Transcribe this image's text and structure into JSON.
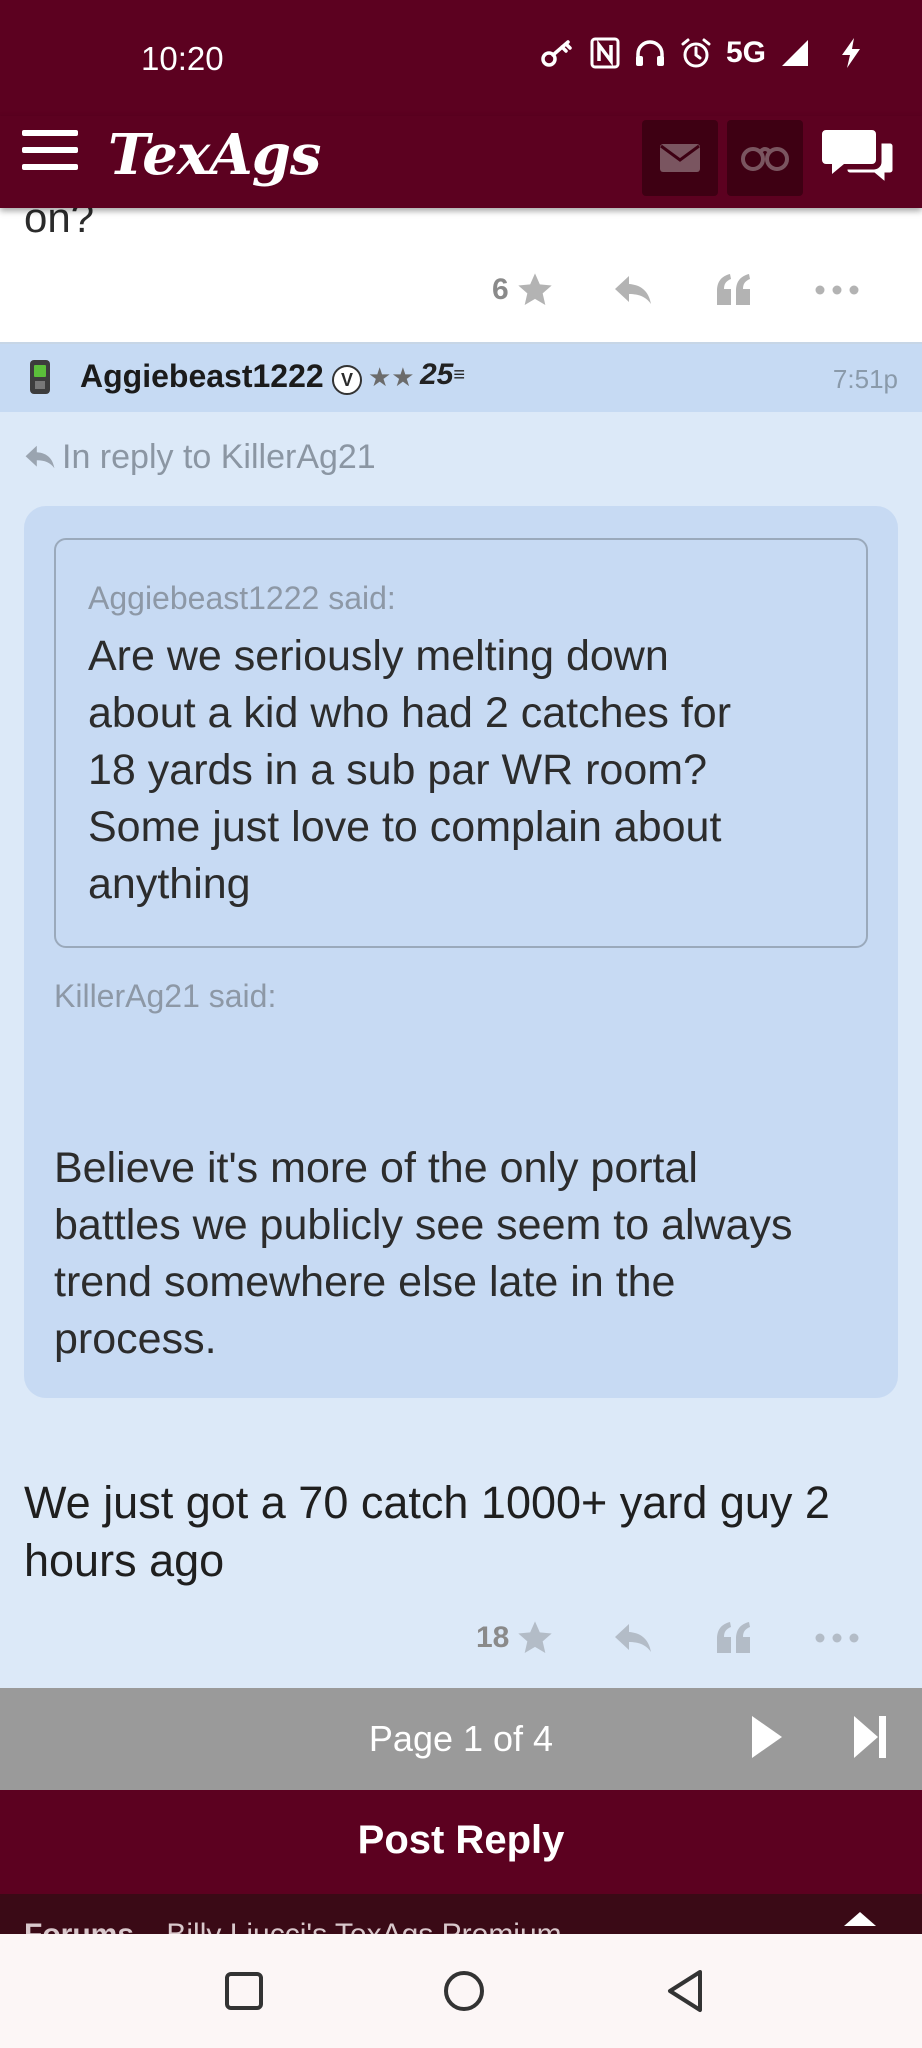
{
  "status_bar": {
    "time": "10:20",
    "network": "5G"
  },
  "app_bar": {
    "logo": "TexAgs"
  },
  "previous_post": {
    "trailing_text": "on?",
    "star_count": "6"
  },
  "post": {
    "username": "Aggiebeast1222",
    "verified_badge": "V",
    "stars": "★★",
    "year_badge": "25",
    "time": "7:51p",
    "in_reply_to": "In reply to KillerAg21",
    "nested_quote": {
      "said_label": "Aggiebeast1222 said:",
      "lines": [
        "Are we seriously melting down",
        "about a kid who had 2 catches for",
        "18 yards in a sub par WR room?",
        "Some just love to complain about",
        "anything"
      ]
    },
    "outer_quote": {
      "said_label": "KillerAg21 said:",
      "lines": [
        "Believe it's more of the only portal",
        "battles we publicly see seem to always",
        "trend somewhere else late in the",
        "process."
      ]
    },
    "reply_lines": [
      "We just got a 70 catch 1000+ yard guy 2",
      "hours ago"
    ],
    "star_count": "18"
  },
  "pager": {
    "label": "Page 1 of 4"
  },
  "post_reply": {
    "label": "Post Reply"
  },
  "forum_breadcrumb": {
    "first": "Forums",
    "second": "Billy Liucci's TexAgs Premium"
  },
  "colors": {
    "maroon": "#5c0120",
    "post_bg": "#dce9f8",
    "quote_bg": "#c7daf3"
  },
  "icons": [
    "key-icon",
    "nfc-icon",
    "headphones-icon",
    "alarm-icon",
    "signal-icon",
    "charging-icon",
    "menu-icon",
    "mail-icon",
    "binoculars-icon",
    "chat-icon",
    "star-icon",
    "reply-icon",
    "quote-icon",
    "more-icon",
    "phone-icon",
    "play-icon",
    "skip-last-icon",
    "chevron-up-icon",
    "square-nav-icon",
    "home-nav-icon",
    "back-nav-icon"
  ]
}
